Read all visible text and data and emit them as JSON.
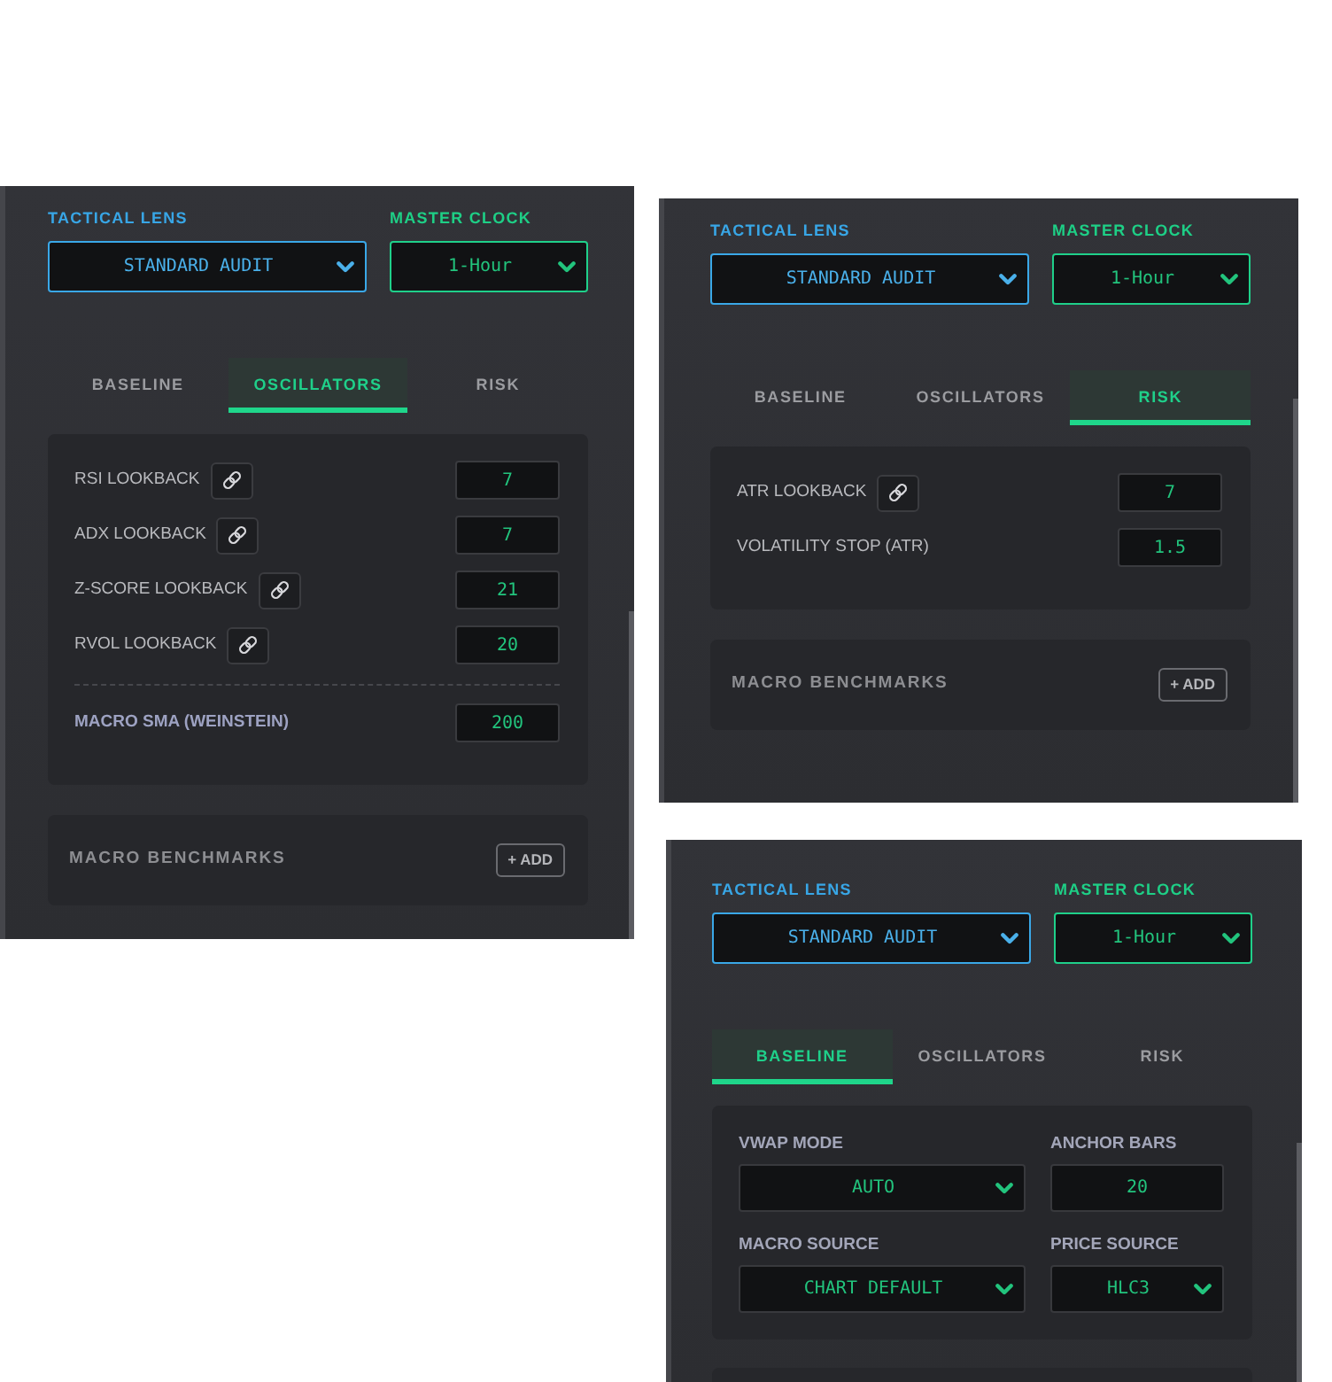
{
  "panels": [
    {
      "lens": {
        "label": "TACTICAL LENS",
        "value": "STANDARD AUDIT"
      },
      "clock": {
        "label": "MASTER CLOCK",
        "value": "1-Hour"
      },
      "tabs": [
        {
          "label": "BASELINE",
          "selected": false
        },
        {
          "label": "OSCILLATORS",
          "selected": true
        },
        {
          "label": "RISK",
          "selected": false
        }
      ],
      "settings": {
        "kind": "rows",
        "rows": [
          {
            "kind": "linked",
            "label": "RSI LOOKBACK",
            "value": "7"
          },
          {
            "kind": "linked",
            "label": "ADX LOOKBACK",
            "value": "7"
          },
          {
            "kind": "linked",
            "label": "Z-SCORE LOOKBACK",
            "value": "21"
          },
          {
            "kind": "linked",
            "label": "RVOL LOOKBACK",
            "value": "20"
          },
          {
            "kind": "macro",
            "label": "MACRO SMA (WEINSTEIN)",
            "value": "200"
          }
        ]
      },
      "benchmarks": {
        "title": "MACRO BENCHMARKS",
        "button": "+ ADD"
      }
    },
    {
      "lens": {
        "label": "TACTICAL LENS",
        "value": "STANDARD AUDIT"
      },
      "clock": {
        "label": "MASTER CLOCK",
        "value": "1-Hour"
      },
      "tabs": [
        {
          "label": "BASELINE",
          "selected": false
        },
        {
          "label": "OSCILLATORS",
          "selected": false
        },
        {
          "label": "RISK",
          "selected": true
        }
      ],
      "settings": {
        "kind": "rows",
        "rows": [
          {
            "kind": "linked",
            "label": "ATR LOOKBACK",
            "value": "7"
          },
          {
            "kind": "plain",
            "label": "VOLATILITY STOP (ATR)",
            "value": "1.5"
          }
        ]
      },
      "benchmarks": {
        "title": "MACRO BENCHMARKS",
        "button": "+ ADD"
      }
    },
    {
      "lens": {
        "label": "TACTICAL LENS",
        "value": "STANDARD AUDIT"
      },
      "clock": {
        "label": "MASTER CLOCK",
        "value": "1-Hour"
      },
      "tabs": [
        {
          "label": "BASELINE",
          "selected": true
        },
        {
          "label": "OSCILLATORS",
          "selected": false
        },
        {
          "label": "RISK",
          "selected": false
        }
      ],
      "settings": {
        "kind": "grid",
        "fields": [
          {
            "kind": "select",
            "label": "VWAP MODE",
            "value": "AUTO"
          },
          {
            "kind": "number",
            "label": "ANCHOR BARS",
            "value": "20"
          },
          {
            "kind": "select",
            "label": "MACRO SOURCE",
            "value": "CHART DEFAULT"
          },
          {
            "kind": "select",
            "label": "PRICE SOURCE",
            "value": "HLC3"
          }
        ]
      }
    }
  ]
}
